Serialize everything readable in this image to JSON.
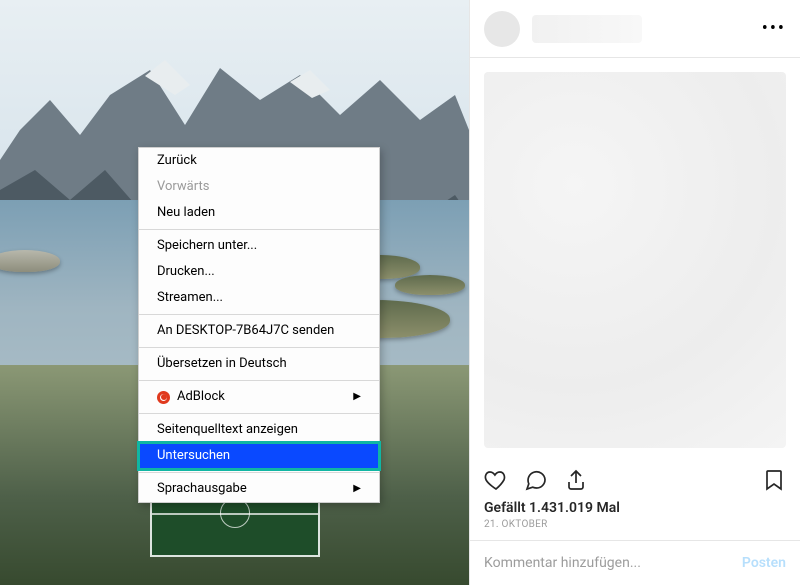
{
  "context_menu": {
    "back": "Zurück",
    "forward": "Vorwärts",
    "reload": "Neu laden",
    "save_as": "Speichern unter...",
    "print": "Drucken...",
    "stream": "Streamen...",
    "send_to": "An DESKTOP-7B64J7C senden",
    "translate": "Übersetzen in Deutsch",
    "adblock": "AdBlock",
    "view_source": "Seitenquelltext anzeigen",
    "inspect": "Untersuchen",
    "speech": "Sprachausgabe"
  },
  "post": {
    "likes_text": "Gefällt 1.431.019 Mal",
    "date_text": "21. Oktober",
    "comment_placeholder": "Kommentar hinzufügen...",
    "post_button": "Posten",
    "more_dots": "•••"
  }
}
